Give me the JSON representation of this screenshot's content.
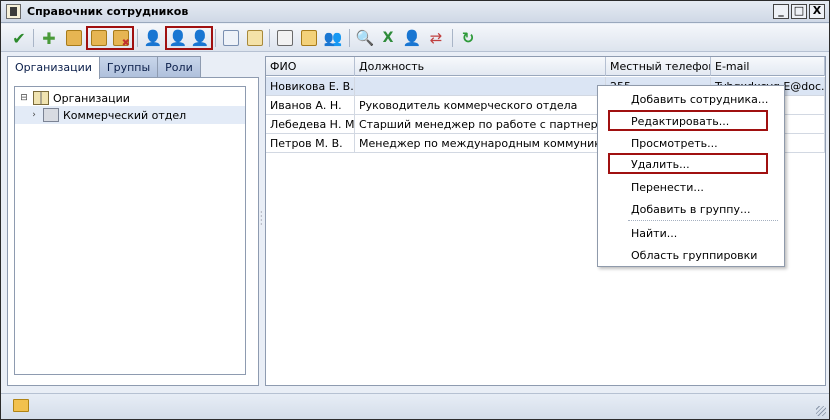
{
  "window": {
    "title": "Справочник сотрудников",
    "controls": [
      "_",
      "□",
      "X"
    ]
  },
  "toolbar": {
    "buttons": [
      {
        "icon": "checkmark-icon",
        "color": "#2c8a2c"
      },
      {
        "icon": "add-organization-icon",
        "color": "#4a9a3a"
      },
      {
        "icon": "add-folder-icon",
        "color": "#d9a23a"
      },
      {
        "icon": "edit-folder-icon",
        "color": "#d9a23a"
      },
      {
        "icon": "delete-folder-icon",
        "color": "#d9a23a"
      },
      {
        "icon": "add-user-icon",
        "color": "#5d8a3a"
      },
      {
        "icon": "edit-user-icon",
        "color": "#6c9a3a"
      },
      {
        "icon": "delete-user-icon",
        "color": "#c04040"
      },
      {
        "icon": "card-icon",
        "color": "#7a8fb0"
      },
      {
        "icon": "card-edit-icon",
        "color": "#d9b24a"
      },
      {
        "icon": "group-icon",
        "color": "#6a6a6a"
      },
      {
        "icon": "group-active-icon",
        "color": "#d9a23a"
      },
      {
        "icon": "users-disabled-icon",
        "color": "#b0b0b0"
      },
      {
        "icon": "search-icon",
        "color": "#4a7ab0"
      },
      {
        "icon": "excel-icon",
        "color": "#2e8b3a"
      },
      {
        "icon": "user-key-icon",
        "color": "#d9b24a"
      },
      {
        "icon": "user-transfer-icon",
        "color": "#c04040"
      },
      {
        "icon": "refresh-icon",
        "color": "#2e9a3a"
      }
    ]
  },
  "left_panel": {
    "tabs": [
      "Организации",
      "Группы",
      "Роли"
    ],
    "active_tab": "Организации",
    "tree": [
      {
        "label": "Организации",
        "expander": "⊟",
        "icon": "book-icon"
      },
      {
        "label": "Коммерческий отдел",
        "expander": "›",
        "icon": "department-icon"
      }
    ]
  },
  "grid": {
    "columns": [
      "ФИО",
      "Должность",
      "Местный телефон",
      "E-mail"
    ],
    "rows": [
      [
        "Новикова Е. В.",
        "",
        "255",
        "Tyhgxdxcvg E@doc..."
      ],
      [
        "Иванов А. Н.",
        "Руководитель коммерческого отдела",
        "",
        ""
      ],
      [
        "Лебедева Н. М.",
        "Старший менеджер по работе с партнерами",
        "",
        ""
      ],
      [
        "Петров М. В.",
        "Менеджер по международным коммуникациям",
        "",
        ""
      ]
    ],
    "selected_row": 0
  },
  "context_menu": {
    "items": [
      "Добавить сотрудника...",
      "Редактировать...",
      "Просмотреть...",
      "Удалить...",
      "Перенести...",
      "Добавить в группу...",
      "Найти...",
      "Область группировки"
    ],
    "highlighted": [
      "Редактировать...",
      "Удалить..."
    ]
  },
  "statusbar": {
    "icon": "folder-icon"
  },
  "colors": {
    "highlight_border": "#a01010",
    "selection": "#dbe5f4"
  }
}
